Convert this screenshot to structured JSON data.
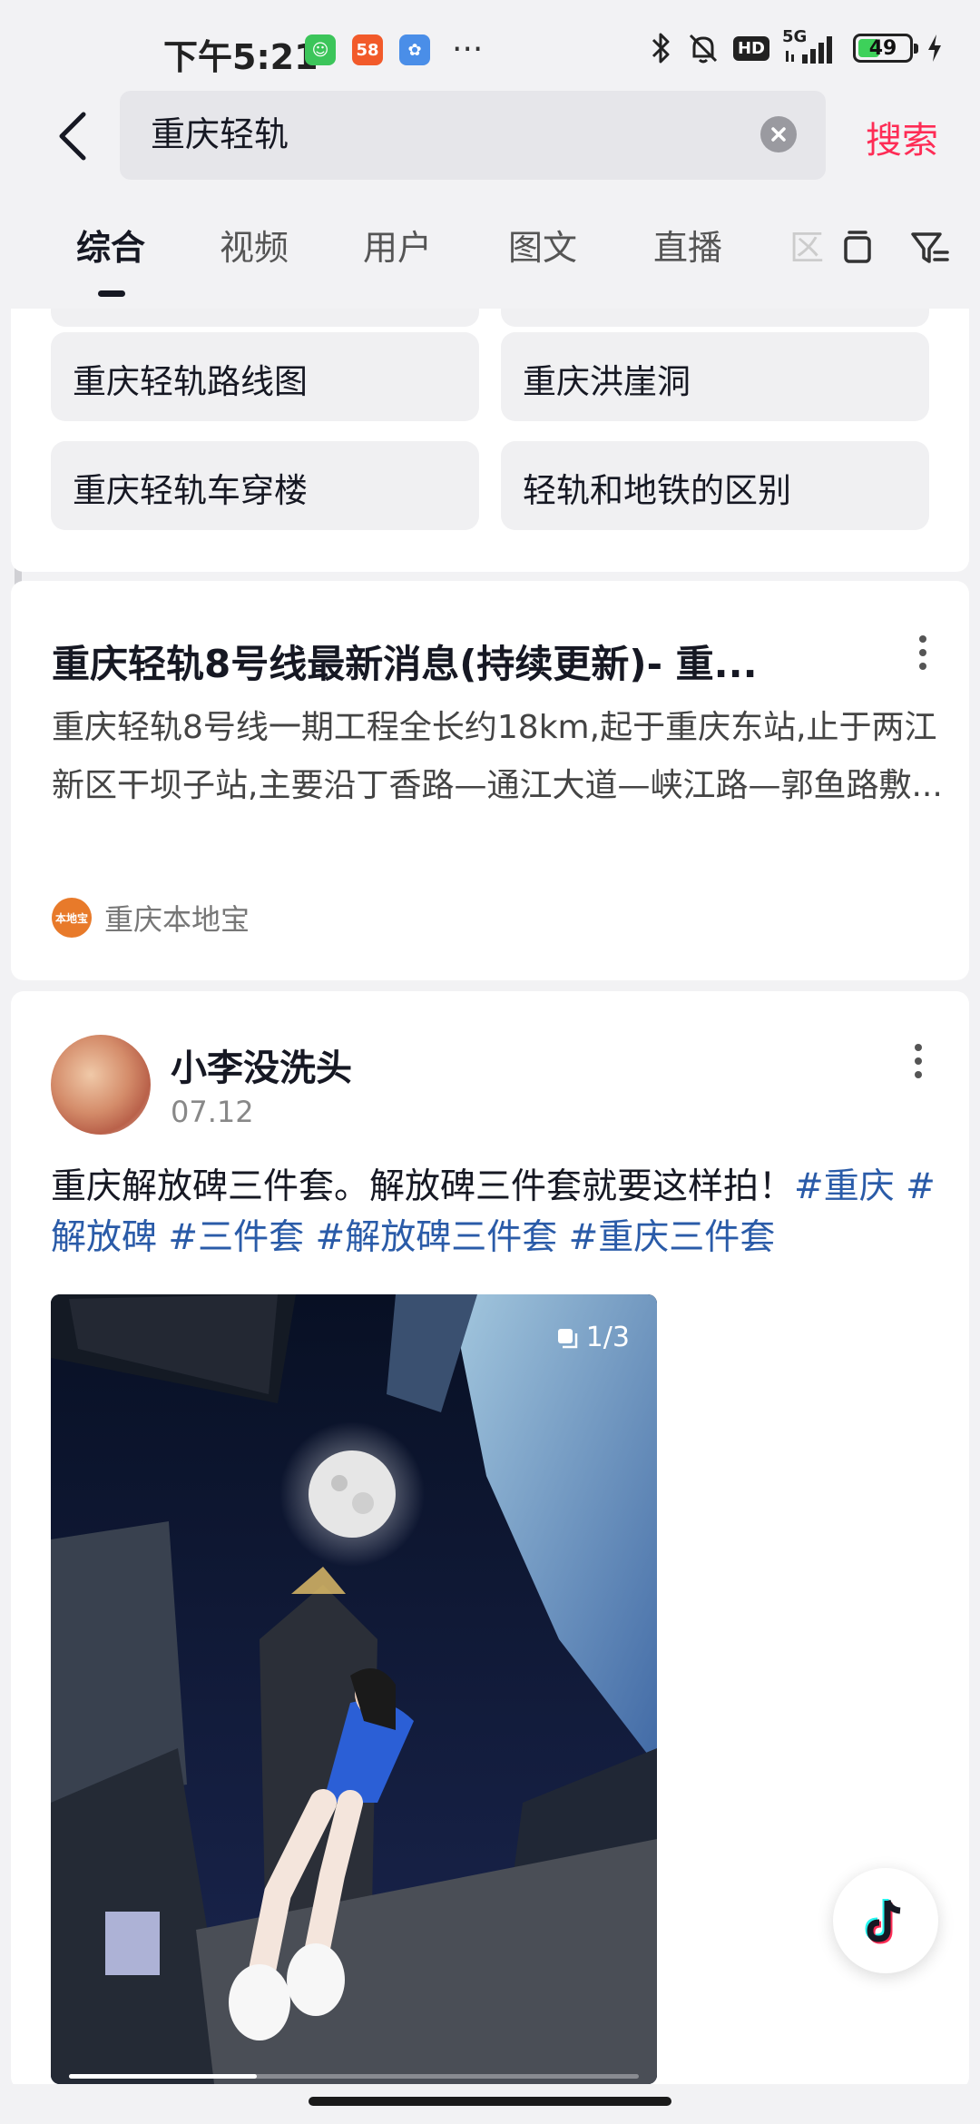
{
  "status_bar": {
    "time": "下午5:21",
    "apps": [
      {
        "name": "cat-app-icon",
        "glyph": "☺",
        "color": "#3cc55a"
      },
      {
        "name": "58-app-icon",
        "glyph": "58",
        "color": "#f25a2a"
      },
      {
        "name": "cloud-app-icon",
        "glyph": "✿",
        "color": "#4a8ee8"
      }
    ],
    "more": "···",
    "network": "5G",
    "hd": "HD",
    "battery": 49
  },
  "search": {
    "query": "重庆轻轨",
    "submit_label": "搜索"
  },
  "tabs": [
    {
      "label": "综合",
      "active": true
    },
    {
      "label": "视频"
    },
    {
      "label": "用户"
    },
    {
      "label": "图文"
    },
    {
      "label": "直播"
    }
  ],
  "tabs_overflow": "区",
  "related_searches": [
    "重庆轻轨路线图",
    "重庆洪崖洞",
    "重庆轻轨车穿楼",
    "轻轨和地铁的区别"
  ],
  "article": {
    "title": "重庆轻轨8号线最新消息(持续更新)- 重...",
    "body": "重庆轻轨8号线一期工程全长约18km,起于重庆东站,止于两江新区干坝子站,主要沿丁香路—通江大道—峡江路—郭鱼路敷...",
    "source": "重庆本地宝",
    "source_logo_text": "本地宝"
  },
  "post": {
    "username": "小李没洗头",
    "date": "07.12",
    "text": "重庆解放碑三件套。解放碑三件套就要这样拍！",
    "tags": [
      "#重庆",
      "#解放碑",
      "#三件套",
      "#解放碑三件套",
      "#重庆三件套"
    ],
    "image_counter": "1/3",
    "image_progress": 0.33
  }
}
